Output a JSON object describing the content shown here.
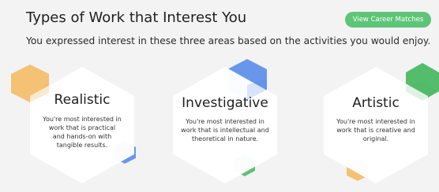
{
  "header": {
    "title": "Types of Work that Interest You",
    "subtitle": "You expressed interest in these three areas based on the activities you would enjoy.",
    "button_label": "View Career Matches"
  },
  "colors": {
    "accent_green": "#5dc578",
    "orange": "#f5b04a",
    "blue": "#4f86e8",
    "green": "#43b75d"
  },
  "cards": [
    {
      "title": "Realistic",
      "description": "You're most interested in work that is practical and hands-on with tangible results."
    },
    {
      "title": "Investigative",
      "description": "You're most interested in work that is intellectual and theoretical in nature."
    },
    {
      "title": "Artistic",
      "description": "You're most interested in work that is creative and original."
    }
  ]
}
